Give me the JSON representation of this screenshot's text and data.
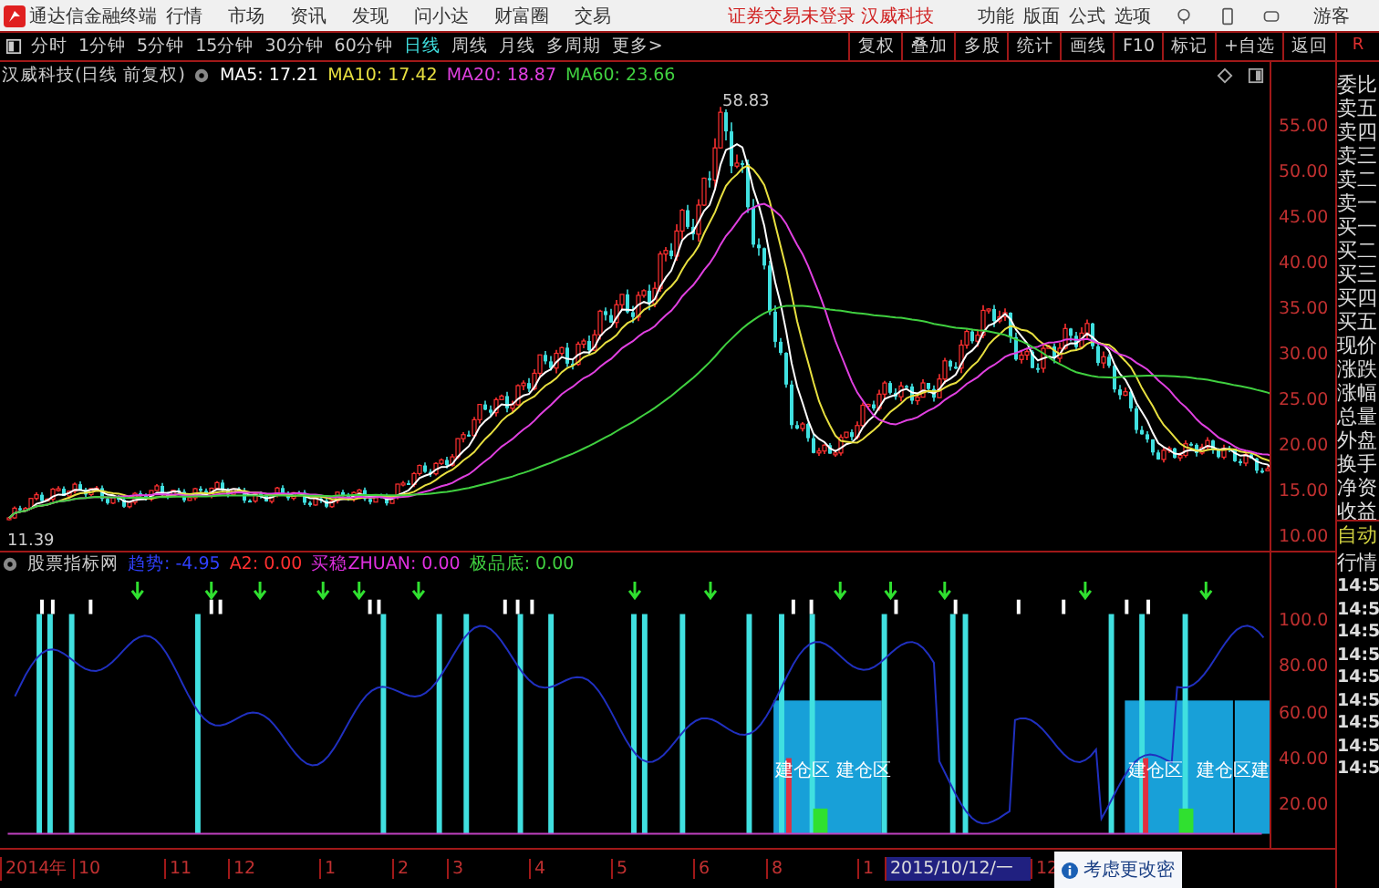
{
  "title_bar": {
    "app_name": "通达信金融终端",
    "menus": [
      "行情",
      "市场",
      "资讯",
      "发现",
      "问小达",
      "财富圈",
      "交易"
    ],
    "notice": "证券交易未登录 汉威科技",
    "tools": [
      "功能",
      "版面",
      "公式",
      "选项"
    ],
    "user": "游客"
  },
  "periods": [
    {
      "label": "分时",
      "selected": false
    },
    {
      "label": "1分钟",
      "selected": false
    },
    {
      "label": "5分钟",
      "selected": false
    },
    {
      "label": "15分钟",
      "selected": false
    },
    {
      "label": "30分钟",
      "selected": false
    },
    {
      "label": "60分钟",
      "selected": false
    },
    {
      "label": "日线",
      "selected": true
    },
    {
      "label": "周线",
      "selected": false
    },
    {
      "label": "月线",
      "selected": false
    },
    {
      "label": "多周期",
      "selected": false
    },
    {
      "label": "更多>",
      "selected": false
    }
  ],
  "chart_tools": [
    "复权",
    "叠加",
    "多股",
    "统计",
    "画线",
    "F10",
    "标记",
    "+自选",
    "返回"
  ],
  "main_chart": {
    "title": "汉威科技(日线 前复权)",
    "indicators": [
      {
        "text": "MA5: 17.21",
        "color": "#ffffff"
      },
      {
        "text": "MA10: 17.42",
        "color": "#e8e040"
      },
      {
        "text": "MA20: 18.87",
        "color": "#e040e0"
      },
      {
        "text": "MA60: 23.66",
        "color": "#40d040"
      }
    ],
    "high_label": "58.83",
    "low_label": "11.39",
    "y_ticks": [
      "55.00",
      "50.00",
      "45.00",
      "40.00",
      "35.00",
      "30.00",
      "25.00",
      "20.00",
      "15.00",
      "10.00"
    ]
  },
  "indicator_pane": {
    "title": "股票指标网",
    "values": [
      {
        "text": "趋势: -4.95",
        "color": "#3040ff"
      },
      {
        "text": "A2: 0.00",
        "color": "#ff3030"
      },
      {
        "text": "买稳ZHUAN: 0.00",
        "color": "#e030e0"
      },
      {
        "text": "极品底: 0.00",
        "color": "#40d040"
      }
    ],
    "zone_labels": [
      "建仓区",
      "建仓区",
      "建仓区",
      "建仓区",
      "建"
    ],
    "y_ticks": [
      "100.0",
      "80.00",
      "60.00",
      "40.00",
      "20.00"
    ]
  },
  "date_axis": [
    {
      "label": "2014年",
      "selected": false
    },
    {
      "label": "10",
      "selected": false
    },
    {
      "label": "11",
      "selected": false
    },
    {
      "label": "12",
      "selected": false
    },
    {
      "label": "1",
      "selected": false
    },
    {
      "label": "2",
      "selected": false
    },
    {
      "label": "3",
      "selected": false
    },
    {
      "label": "4",
      "selected": false
    },
    {
      "label": "5",
      "selected": false
    },
    {
      "label": "6",
      "selected": false
    },
    {
      "label": "8",
      "selected": false
    },
    {
      "label": "1",
      "selected": false
    },
    {
      "label": "2015/10/12/一",
      "selected": true
    },
    {
      "label": "12",
      "selected": false
    }
  ],
  "side_panel": {
    "top": "R",
    "quote_rows": [
      "委比",
      "卖五",
      "卖四",
      "卖三",
      "卖二",
      "卖一",
      "买一",
      "买二",
      "买三",
      "买四",
      "买五",
      "现价",
      "涨跌",
      "涨幅",
      "总量",
      "外盘",
      "换手",
      "净资",
      "收益"
    ],
    "tabs": [
      {
        "label": "自动",
        "selected": true
      },
      {
        "label": "行情",
        "selected": false
      }
    ],
    "times": [
      "14:5",
      "14:5",
      "14:5",
      "14:5",
      "14:5",
      "14:5",
      "14:5",
      "14:5",
      "14:5"
    ]
  },
  "toast": "考虑更改密"
}
